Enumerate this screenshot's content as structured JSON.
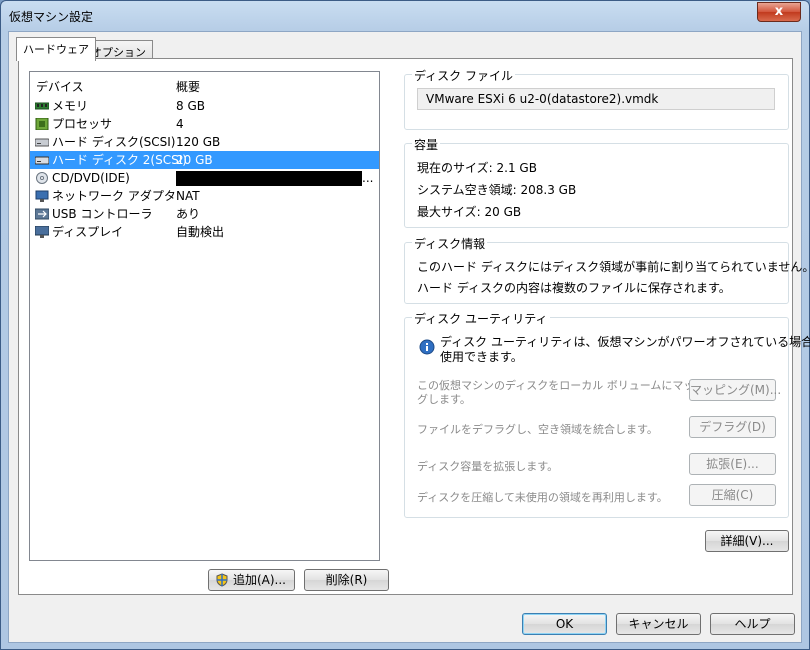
{
  "window": {
    "title": "仮想マシン設定",
    "close_glyph": "x"
  },
  "tabs": [
    {
      "label": "ハードウェア",
      "active": true
    },
    {
      "label": "オプション",
      "active": false
    }
  ],
  "device_list": {
    "columns": {
      "device": "デバイス",
      "summary": "概要"
    },
    "rows": [
      {
        "name": "メモリ",
        "summary": "8 GB",
        "icon": "memory-icon"
      },
      {
        "name": "プロセッサ",
        "summary": "4",
        "icon": "cpu-icon"
      },
      {
        "name": "ハード ディスク(SCSI)",
        "summary": "120 GB",
        "icon": "hard-disk-icon"
      },
      {
        "name": "ハード ディスク 2(SCSI)",
        "summary": "20 GB",
        "icon": "hard-disk-icon",
        "selected": true
      },
      {
        "name": "CD/DVD(IDE)",
        "summary": "",
        "redacted": true,
        "icon": "cd-dvd-icon"
      },
      {
        "name": "ネットワーク アダプタ",
        "summary": "NAT",
        "icon": "network-icon"
      },
      {
        "name": "USB コントローラ",
        "summary": "あり",
        "icon": "usb-icon"
      },
      {
        "name": "ディスプレイ",
        "summary": "自動検出",
        "icon": "monitor-icon"
      }
    ],
    "ellipsis": "...",
    "add_button": "追加(A)...",
    "remove_button": "削除(R)"
  },
  "disk_file": {
    "title": "ディスク ファイル",
    "value": "VMware ESXi 6 u2-0(datastore2).vmdk"
  },
  "capacity": {
    "title": "容量",
    "current_size": "現在のサイズ:  2.1 GB",
    "system_free": "システム空き領域:  208.3 GB",
    "max_size": "最大サイズ:  20 GB"
  },
  "disk_info": {
    "title": "ディスク情報",
    "line1": "このハード ディスクにはディスク領域が事前に割り当てられていません。",
    "line2": "ハード ディスクの内容は複数のファイルに保存されます。"
  },
  "disk_utility": {
    "title": "ディスク ユーティリティ",
    "info_line1": "ディスク ユーティリティは、仮想マシンがパワーオフされている場合にのみ",
    "info_line2": "使用できます。",
    "map_desc1": "この仮想マシンのディスクをローカル ボリュームにマッピン",
    "map_desc2": "グします。",
    "map_button": "マッピング(M)...",
    "defrag_desc": "ファイルをデフラグし、空き領域を統合します。",
    "defrag_button": "デフラグ(D)",
    "expand_desc": "ディスク容量を拡張します。",
    "expand_button": "拡張(E)...",
    "compact_desc": "ディスクを圧縮して未使用の領域を再利用します。",
    "compact_button": "圧縮(C)"
  },
  "details_button": "詳細(V)...",
  "footer": {
    "ok": "OK",
    "cancel": "キャンセル",
    "help": "ヘルプ"
  }
}
